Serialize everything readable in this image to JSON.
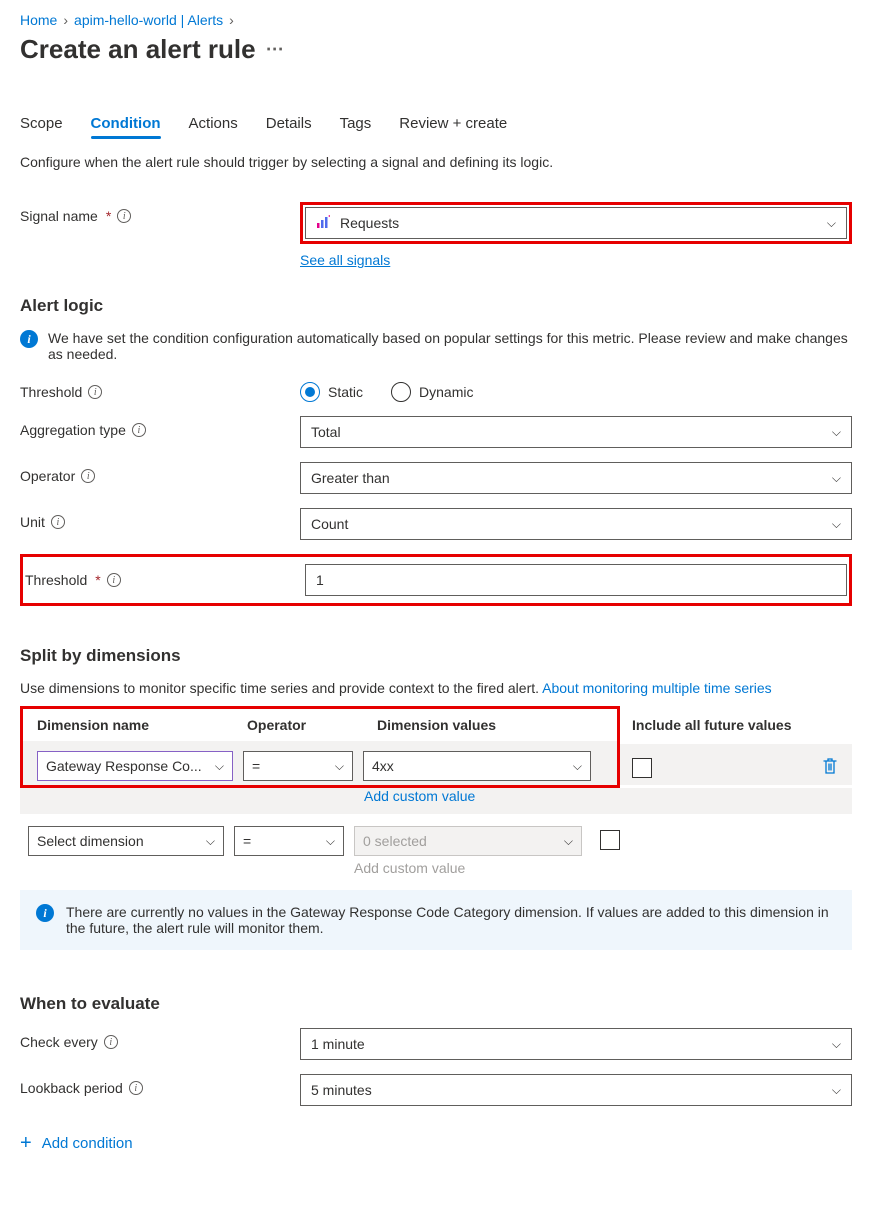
{
  "breadcrumb": {
    "home": "Home",
    "item": "apim-hello-world | Alerts"
  },
  "title": "Create an alert rule",
  "tabs": [
    "Scope",
    "Condition",
    "Actions",
    "Details",
    "Tags",
    "Review + create"
  ],
  "description": "Configure when the alert rule should trigger by selecting a signal and defining its logic.",
  "signal": {
    "label": "Signal name",
    "value": "Requests",
    "see_all": "See all signals"
  },
  "alert_logic": {
    "heading": "Alert logic",
    "info": "We have set the condition configuration automatically based on popular settings for this metric. Please review and make changes as needed.",
    "threshold_label": "Threshold",
    "radio_static": "Static",
    "radio_dynamic": "Dynamic",
    "aggregation_label": "Aggregation type",
    "aggregation_value": "Total",
    "operator_label": "Operator",
    "operator_value": "Greater than",
    "unit_label": "Unit",
    "unit_value": "Count",
    "threshold_value_label": "Threshold",
    "threshold_value": "1"
  },
  "dimensions": {
    "heading": "Split by dimensions",
    "description_prefix": "Use dimensions to monitor specific time series and provide context to the fired alert. ",
    "link": "About monitoring multiple time series",
    "col_name": "Dimension name",
    "col_operator": "Operator",
    "col_values": "Dimension values",
    "col_include": "Include all future values",
    "row1": {
      "name": "Gateway Response Co...",
      "op": "=",
      "val": "4xx",
      "add_custom": "Add custom value"
    },
    "row2": {
      "name": "Select dimension",
      "op": "=",
      "val": "0 selected",
      "add_custom": "Add custom value"
    },
    "warn": "There are currently no values in the Gateway Response Code Category dimension. If values are added to this dimension in the future, the alert rule will monitor them."
  },
  "evaluate": {
    "heading": "When to evaluate",
    "check_label": "Check every",
    "check_value": "1 minute",
    "lookback_label": "Lookback period",
    "lookback_value": "5 minutes"
  },
  "add_condition": "Add condition"
}
